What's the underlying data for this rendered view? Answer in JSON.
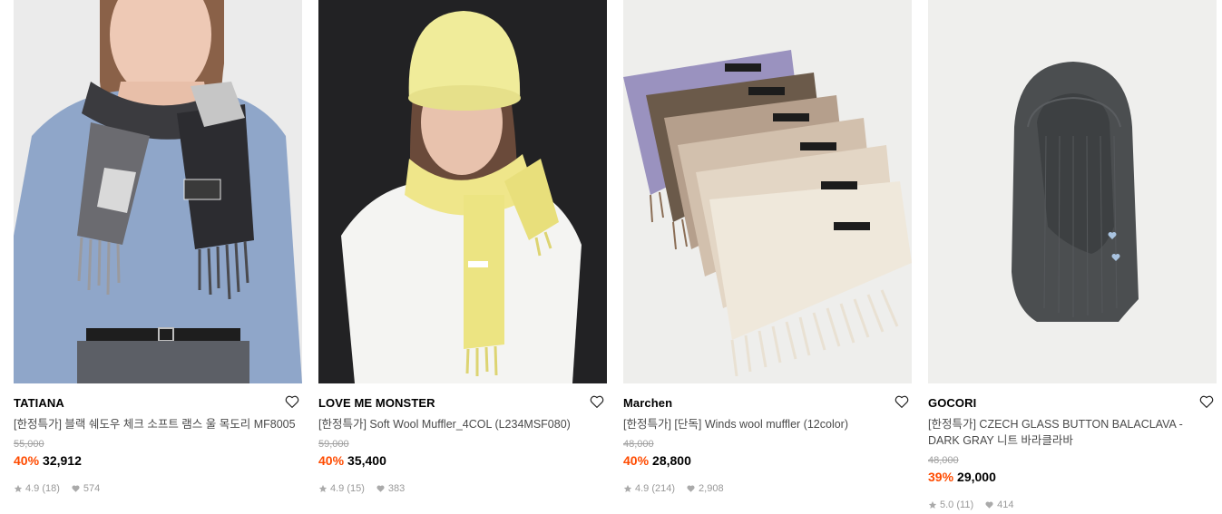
{
  "products": [
    {
      "brand": "TATIANA",
      "title": "[한정특가] 블랙 쉐도우 체크 소프트 램스 울 목도리 MF8005",
      "original_price": "55,000",
      "discount": "40%",
      "price": "32,912",
      "rating": "4.9",
      "reviews": "(18)",
      "likes": "574"
    },
    {
      "brand": "LOVE ME MONSTER",
      "title": "[한정특가] Soft Wool Muffler_4COL (L234MSF080)",
      "original_price": "59,000",
      "discount": "40%",
      "price": "35,400",
      "rating": "4.9",
      "reviews": "(15)",
      "likes": "383"
    },
    {
      "brand": "Marchen",
      "title": "[한정특가] [단독] Winds wool muffler (12color)",
      "original_price": "48,000",
      "discount": "40%",
      "price": "28,800",
      "rating": "4.9",
      "reviews": "(214)",
      "likes": "2,908"
    },
    {
      "brand": "GOCORI",
      "title": "[한정특가] CZECH GLASS BUTTON BALACLAVA - DARK GRAY 니트 바라클라바",
      "original_price": "48,000",
      "discount": "39%",
      "price": "29,000",
      "rating": "5.0",
      "reviews": "(11)",
      "likes": "414"
    }
  ],
  "colors": {
    "discount": "#ff4b00",
    "muted": "#999999"
  },
  "icons": [
    "heart-outline-icon",
    "star-icon",
    "heart-filled-icon"
  ]
}
